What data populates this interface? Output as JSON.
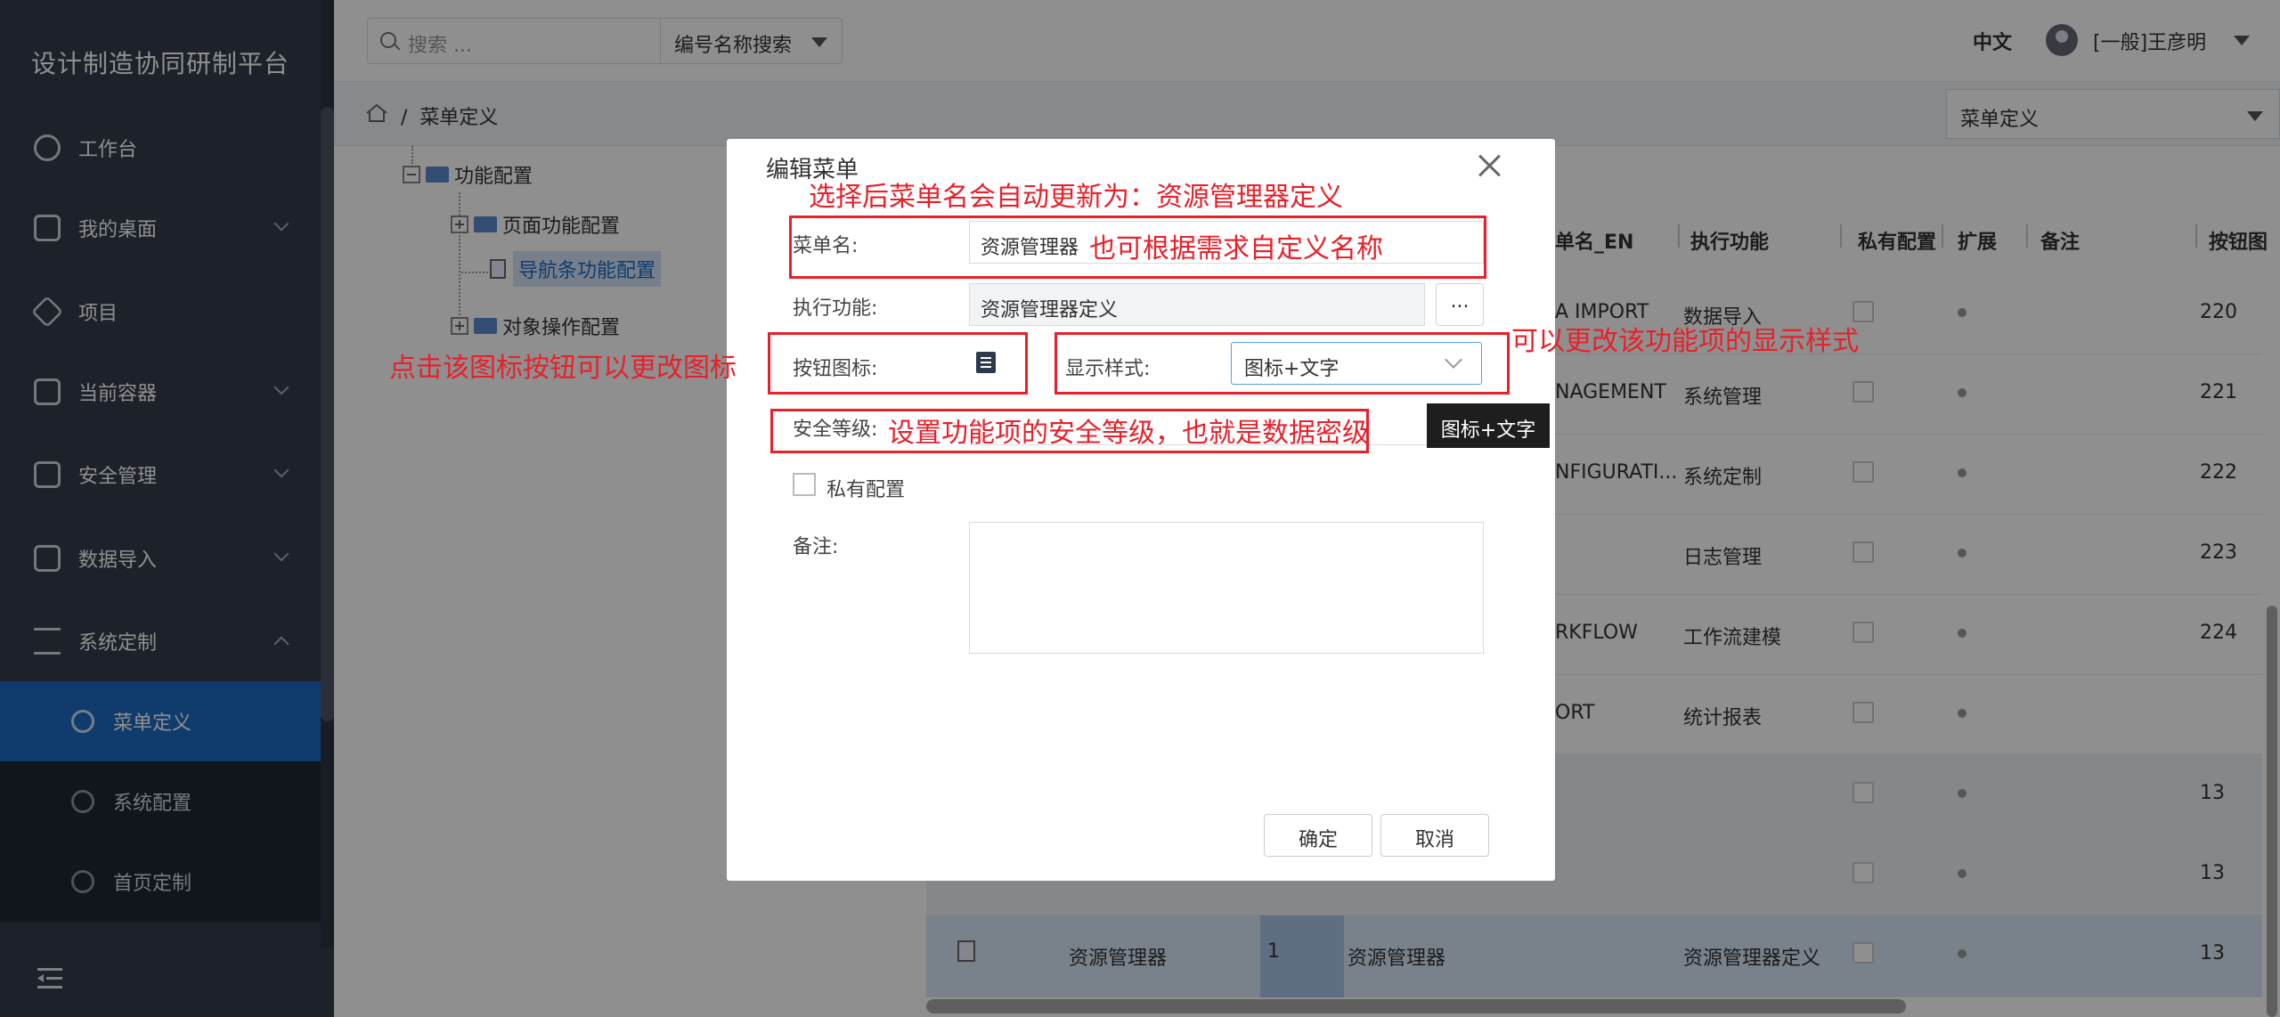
{
  "app": {
    "title": "设计制造协同研制平台"
  },
  "sidebar": {
    "items": [
      {
        "label": "工作台",
        "icon": "dashboard-icon"
      },
      {
        "label": "我的桌面",
        "icon": "desktop-icon"
      },
      {
        "label": "项目",
        "icon": "layers-icon"
      },
      {
        "label": "当前容器",
        "icon": "container-icon"
      },
      {
        "label": "安全管理",
        "icon": "security-icon"
      },
      {
        "label": "数据导入",
        "icon": "import-icon"
      },
      {
        "label": "系统定制",
        "icon": "customize-icon"
      }
    ],
    "subitems": [
      {
        "label": "菜单定义",
        "active": true
      },
      {
        "label": "系统配置",
        "active": false
      },
      {
        "label": "首页定制",
        "active": false
      }
    ]
  },
  "topbar": {
    "search_placeholder": "搜索 ...",
    "search_mode": "编号名称搜索",
    "language": "中文",
    "user": "[一般]王彦明"
  },
  "breadcrumb": {
    "current": "菜单定义",
    "page_select": "菜单定义"
  },
  "tree": {
    "nodes": [
      "功能配置",
      "页面功能配置",
      "导航条功能配置",
      "对象操作配置"
    ]
  },
  "table": {
    "headers": [
      "单名_EN",
      "执行功能",
      "私有配置",
      "扩展",
      "备注",
      "按钮图"
    ],
    "rows": [
      {
        "en": "A IMPORT",
        "func": "数据导入",
        "num": "220"
      },
      {
        "en": "NAGEMENT",
        "func": "系统管理",
        "num": "221"
      },
      {
        "en": "NFIGURATI...",
        "func": "系统定制",
        "num": "222"
      },
      {
        "en": "",
        "func": "日志管理",
        "num": "223"
      },
      {
        "en": "RKFLOW",
        "func": "工作流建模",
        "num": "224"
      },
      {
        "en": "ORT",
        "func": "统计报表",
        "num": ""
      },
      {
        "en": "",
        "func": "",
        "num": "13"
      },
      {
        "en": "",
        "func": "",
        "num": "13"
      }
    ],
    "selected_row": {
      "name": "资源管理器",
      "index": "1",
      "cname": "资源管理器",
      "func": "资源管理器定义",
      "num": "13"
    }
  },
  "dialog": {
    "title": "编辑菜单",
    "menu_name_label": "菜单名:",
    "menu_name_value": "资源管理器",
    "exec_label": "执行功能:",
    "exec_value": "资源管理器定义",
    "dots": "...",
    "icon_label": "按钮图标:",
    "style_label": "显示样式:",
    "style_value": "图标+文字",
    "security_label": "安全等级:",
    "private_label": "私有配置",
    "remark_label": "备注:",
    "ok": "确定",
    "cancel": "取消"
  },
  "tooltip": "图标+文字",
  "annotations": {
    "auto_update": "选择后菜单名会自动更新为：资源管理器定义",
    "custom_name": "也可根据需求自定义名称",
    "icon_change": "点击该图标按钮可以更改图标",
    "style_change": "可以更改该功能项的显示样式",
    "security": "设置功能项的安全等级，也就是数据密级"
  },
  "colors": {
    "sidebar": "#343c4b",
    "active": "#1b6bc2",
    "annotation": "#e8202a"
  }
}
